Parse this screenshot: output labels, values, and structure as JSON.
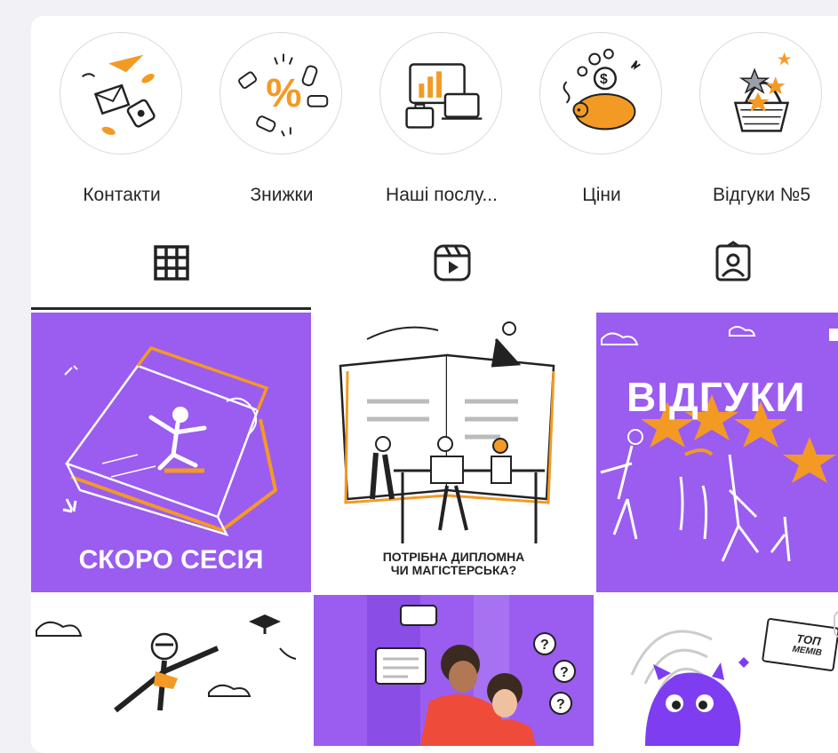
{
  "highlights": [
    {
      "label": "Контакти",
      "icon": "contacts-icon"
    },
    {
      "label": "Знижки",
      "icon": "discount-icon"
    },
    {
      "label": "Наші послу...",
      "icon": "services-icon"
    },
    {
      "label": "Ціни",
      "icon": "piggy-bank-icon"
    },
    {
      "label": "Відгуки №5",
      "icon": "review-basket-icon"
    }
  ],
  "tabs": [
    {
      "name": "posts",
      "icon": "grid-icon",
      "active": true
    },
    {
      "name": "reels",
      "icon": "reels-icon",
      "active": false
    },
    {
      "name": "tagged",
      "icon": "tagged-user-icon",
      "active": false
    }
  ],
  "posts": [
    {
      "caption": "СКОРО СЕСІЯ"
    },
    {
      "caption_line1": "ПОТРІБНА ДИПЛОМНА",
      "caption_line2": "ЧИ МАГІСТЕРСЬКА?"
    },
    {
      "caption": "ВІДГУКИ"
    },
    {
      "caption": ""
    },
    {
      "caption": ""
    },
    {
      "caption_line1": "ТОП",
      "caption_line2": "МЕМІВ"
    }
  ],
  "colors": {
    "purple": "#9b5cf0",
    "orange": "#f39a25",
    "text": "#262626",
    "border": "#d9d9d9"
  }
}
